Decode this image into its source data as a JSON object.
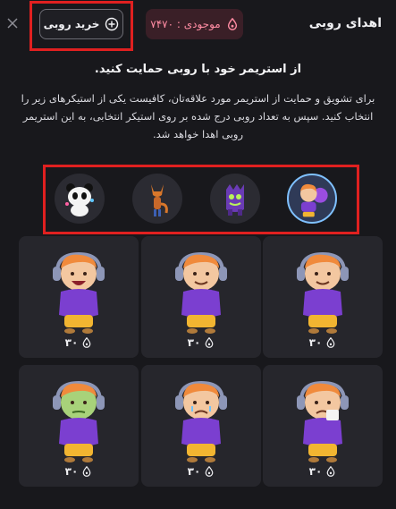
{
  "header": {
    "title": "اهدای روبی",
    "balance_label": "موجودی : ۷۴۷۰",
    "buy_label": "خرید روبی"
  },
  "headline": "از استریمر خود با روبی حمایت کنید.",
  "description": "برای تشویق و حمایت از استریمر مورد علاقه‌تان، کافیست یکی از استیکرهای زیر را انتخاب کنید. سپس به تعداد روبی درج شده بر روی استیکر انتخابی، به این استریمر روبی اهدا خواهد شد.",
  "sticker_packs": [
    {
      "name": "boy-pack",
      "active": true
    },
    {
      "name": "monster-pack",
      "active": false
    },
    {
      "name": "fox-pack",
      "active": false
    },
    {
      "name": "panda-pack",
      "active": false
    }
  ],
  "stickers": [
    {
      "mood": "wave",
      "price": "۳۰"
    },
    {
      "mood": "smile",
      "price": "۳۰"
    },
    {
      "mood": "laugh",
      "price": "۳۰"
    },
    {
      "mood": "cry",
      "price": "۳۰"
    },
    {
      "mood": "sad",
      "price": "۳۰"
    },
    {
      "mood": "sick",
      "price": "۳۰"
    }
  ],
  "colors": {
    "accent_red": "#e02020",
    "ruby": "#ff8ca3",
    "shirt": "#7b3fd0",
    "pants": "#f2b531",
    "hair": "#f08a3c",
    "headphones": "#8d96b7"
  }
}
